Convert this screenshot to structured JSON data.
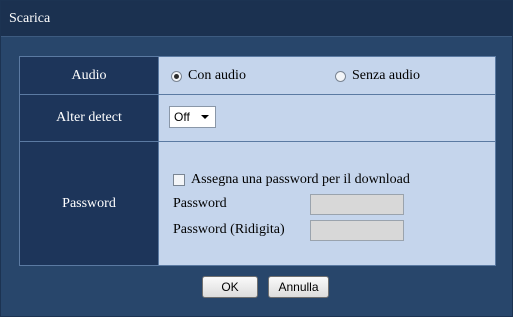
{
  "dialog": {
    "title": "Scarica"
  },
  "audio": {
    "label": "Audio",
    "options": [
      {
        "label": "Con audio",
        "selected": true
      },
      {
        "label": "Senza audio",
        "selected": false
      }
    ]
  },
  "alter_detect": {
    "label": "Alter detect",
    "selected_value": "Off"
  },
  "password": {
    "label": "Password",
    "checkbox_label": "Assegna una password per il download",
    "checkbox_checked": false,
    "field_password_label": "Password",
    "field_password_value": "",
    "field_retype_label": "Password (Ridigita)",
    "field_retype_value": ""
  },
  "buttons": {
    "ok_label": "OK",
    "cancel_label": "Annulla"
  },
  "colors": {
    "dialog_bg": "#28466b",
    "label_cell_bg": "#1d355a",
    "value_cell_bg": "#c5d5ec"
  }
}
